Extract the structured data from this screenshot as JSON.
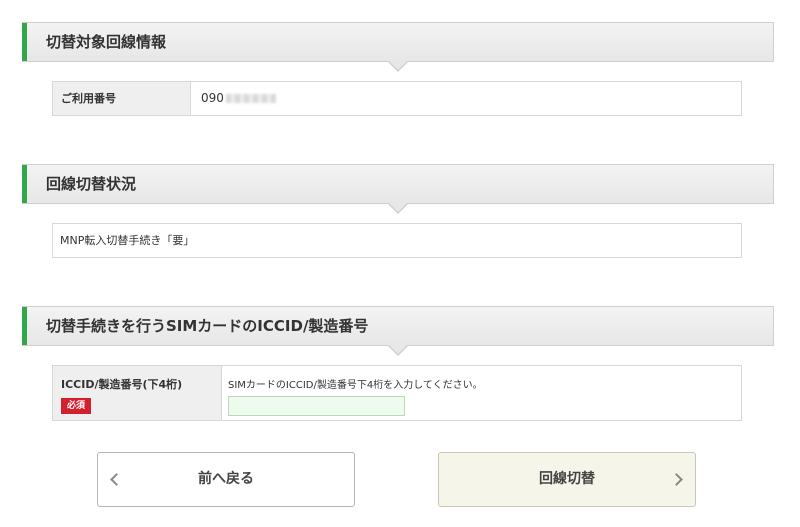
{
  "sections": [
    {
      "title": "切替対象回線情報"
    },
    {
      "title": "回線切替状況"
    },
    {
      "title": "切替手続きを行うSIMカードのICCID/製造番号"
    }
  ],
  "line_info": {
    "label": "ご利用番号",
    "value_prefix": "090"
  },
  "status": {
    "text": "MNP転入切替手続き「要」"
  },
  "iccid": {
    "label": "ICCID/製造番号(下4桁)",
    "required_badge": "必須",
    "instruction": "SIMカードのICCID/製造番号下4桁を入力してください。",
    "value": ""
  },
  "buttons": {
    "back_label": "前へ戻る",
    "next_label": "回線切替"
  },
  "colors": {
    "accent_bar": "#2ea84a",
    "required_badge": "#d3202e",
    "input_bg": "#eefaee"
  }
}
